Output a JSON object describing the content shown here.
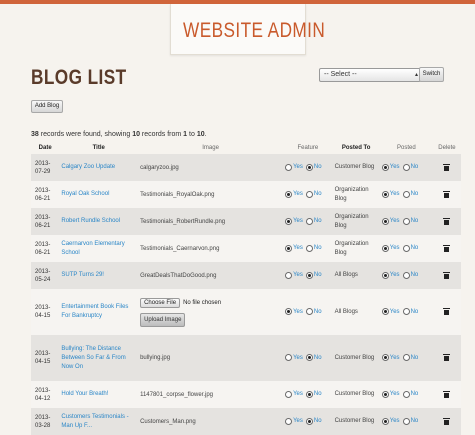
{
  "header": {
    "title": "WEBSITE ADMIN"
  },
  "page": {
    "heading": "BLOG LIST"
  },
  "filter": {
    "selected": "-- Select --",
    "switch_label": "Switch"
  },
  "toolbar": {
    "add_blog": "Add Blog"
  },
  "summary": {
    "total": "38",
    "text1": " records were found, showing ",
    "shown": "10",
    "text2": " records from ",
    "from": "1",
    "text3": " to ",
    "to": "10",
    "text4": "."
  },
  "columns": [
    "Date",
    "Title",
    "Image",
    "Feature",
    "Posted To",
    "Posted",
    "Delete"
  ],
  "radio_labels": {
    "yes": "Yes",
    "no": "No"
  },
  "upload": {
    "choose": "Choose File",
    "nofile": "No file chosen",
    "button": "Upload Image"
  },
  "rows": [
    {
      "date": "2013-07-29",
      "title": "Calgary Zoo Update",
      "image": "calgaryzoo.jpg",
      "feature": "no",
      "posted_to": "Customer Blog",
      "posted": "yes"
    },
    {
      "date": "2013-06-21",
      "title": "Royal Oak School",
      "image": "Testimonials_RoyalOak.png",
      "feature": "yes",
      "posted_to": "Organization Blog",
      "posted": "yes"
    },
    {
      "date": "2013-06-21",
      "title": "Robert Rundle School",
      "image": "Testimonials_RobertRundle.png",
      "feature": "yes",
      "posted_to": "Organization Blog",
      "posted": "yes"
    },
    {
      "date": "2013-06-21",
      "title": "Caernarvon Elementary School",
      "image": "Testimonials_Caernarvon.png",
      "feature": "yes",
      "posted_to": "Organization Blog",
      "posted": "yes"
    },
    {
      "date": "2013-05-24",
      "title": "SUTP Turns 29!",
      "image": "GreatDealsThatDoGood.png",
      "feature": "no",
      "posted_to": "All Blogs",
      "posted": "yes"
    },
    {
      "date": "2013-04-15",
      "title": "Entertainment Book Files For Bankruptcy",
      "image": "",
      "feature": "yes",
      "posted_to": "All Blogs",
      "posted": "yes"
    },
    {
      "date": "2013-04-15",
      "title": "Bullying: The Distance Between So Far & From Now On",
      "image": "bullying.jpg",
      "feature": "no",
      "posted_to": "Customer Blog",
      "posted": "yes"
    },
    {
      "date": "2013-04-12",
      "title": "Hold Your Breath!",
      "image": "1147801_corpse_flower.jpg",
      "feature": "no",
      "posted_to": "Customer Blog",
      "posted": "yes"
    },
    {
      "date": "2013-03-28",
      "title": "Customers Testimonials - Man Up F...",
      "image": "Customers_Man.png",
      "feature": "no",
      "posted_to": "Customer Blog",
      "posted": "yes"
    }
  ]
}
